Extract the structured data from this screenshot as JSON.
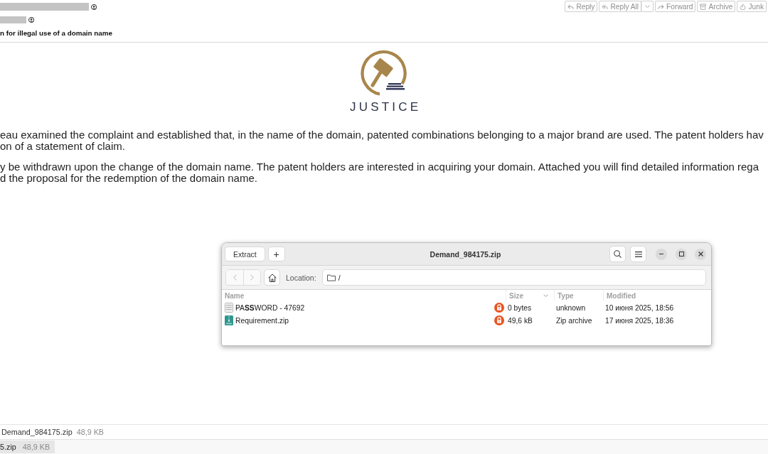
{
  "header": {
    "subject": "n for illegal use of a domain name",
    "actions": [
      {
        "label": "Reply",
        "kind": "button"
      },
      {
        "label": "Reply All",
        "kind": "split"
      },
      {
        "label": "Forward",
        "kind": "button"
      },
      {
        "label": "Archive",
        "kind": "button"
      },
      {
        "label": "Junk",
        "kind": "button"
      }
    ]
  },
  "message": {
    "logo": {
      "text": "JUSTICE"
    },
    "paragraphs": [
      {
        "lines": [
          "eau examined the complaint and established that, in the name of the domain, patented combinations belonging to a major brand are used. The patent holders hav",
          "on of a statement of claim."
        ]
      },
      {
        "lines": [
          "y be withdrawn upon the change of the domain name. The patent holders are interested in acquiring your domain. Attached you will find detailed information rega",
          "d the proposal for the redemption of the domain name."
        ]
      }
    ]
  },
  "archive_window": {
    "title": "Demand_984175.zip",
    "header_buttons": [
      {
        "label": "Extract"
      },
      {
        "label": "+"
      }
    ],
    "nav_buttons": [
      {
        "disabled": true
      },
      {
        "disabled": true
      }
    ],
    "location": {
      "label": "Location:",
      "value": "/"
    },
    "columns": [
      {
        "label": "Name",
        "sorted": false
      },
      {
        "label": "Size",
        "sorted": true
      },
      {
        "label": "Type",
        "sorted": false
      },
      {
        "label": "Modified",
        "sorted": false
      }
    ],
    "rows": [
      {
        "kind": "text",
        "name": "PA**SS**WORD - 47692",
        "locked": true,
        "size": "0 bytes",
        "type": "unknown",
        "modified": "10 июня 2025, 18:56"
      },
      {
        "kind": "zip",
        "name": "Requirement.zip",
        "locked": true,
        "size": "49,6 kB",
        "type": "Zip archive",
        "modified": "17 июня 2025, 18:36"
      }
    ]
  },
  "attachments": [
    {
      "name": "Demand_984175.zip",
      "size": "48,9 KB"
    }
  ],
  "downloads": [
    {
      "name": "5.zip",
      "size": "48,9 KB"
    }
  ]
}
